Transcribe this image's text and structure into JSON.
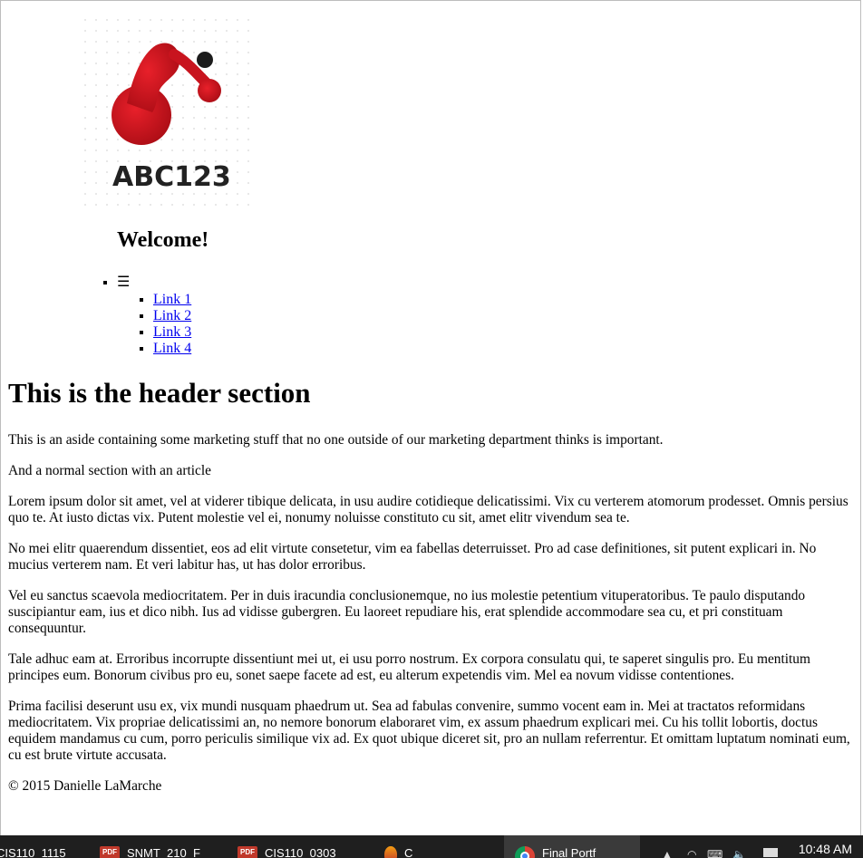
{
  "logo": {
    "text": "ABC123",
    "colors": {
      "primary": "#c8141e",
      "dot": "#1c1c1c",
      "text": "#222222"
    }
  },
  "nav": {
    "welcome": "Welcome!",
    "menu_icon": "☰",
    "links": [
      "Link 1",
      "Link 2",
      "Link 3",
      "Link 4"
    ]
  },
  "header": {
    "title": "This is the header section"
  },
  "aside": {
    "text": "This is an aside containing some marketing stuff that no one outside of our marketing department thinks is important."
  },
  "section": {
    "intro": "And a normal section with an article",
    "paragraphs": [
      "Lorem ipsum dolor sit amet, vel at viderer tibique delicata, in usu audire cotidieque delicatissimi. Vix cu verterem atomorum prodesset. Omnis persius quo te. At iusto dictas vix. Putent molestie vel ei, nonumy noluisse constituto cu sit, amet elitr vivendum sea te.",
      "No mei elitr quaerendum dissentiet, eos ad elit virtute consetetur, vim ea fabellas deterruisset. Pro ad case definitiones, sit putent explicari in. No mucius verterem nam. Et veri labitur has, ut has dolor erroribus.",
      "Vel eu sanctus scaevola mediocritatem. Per in duis iracundia conclusionemque, no ius molestie petentium vituperatoribus. Te paulo disputando suscipiantur eam, ius et dico nibh. Ius ad vidisse gubergren. Eu laoreet repudiare his, erat splendide accommodare sea cu, et pri constituam consequuntur.",
      "Tale adhuc eam at. Erroribus incorrupte dissentiunt mei ut, ei usu porro nostrum. Ex corpora consulatu qui, te saperet singulis pro. Eu mentitum principes eum. Bonorum civibus pro eu, sonet saepe facete ad est, eu alterum expetendis vim. Mel ea novum vidisse contentiones.",
      "Prima facilisi deserunt usu ex, vix mundi nusquam phaedrum ut. Sea ad fabulas convenire, summo vocent eam in. Mei at tractatos reformidans mediocritatem. Vix propriae delicatissimi an, no nemore bonorum elaboraret vim, ex assum phaedrum explicari mei. Cu his tollit lobortis, doctus equidem mandamus cu cum, porro periculis similique vix ad. Ex quot ubique diceret sit, pro an nullam referrentur. Et omittam luptatum nominati eum, cu est brute virtute accusata."
    ]
  },
  "footer": {
    "text": "© 2015 Danielle LaMarche"
  },
  "taskbar": {
    "items": [
      {
        "label": "CIS110_1115",
        "icon": "window-icon"
      },
      {
        "label": "SNMT_210_F",
        "icon": "pdf-icon"
      },
      {
        "label": "CIS110_0303",
        "icon": "pdf-icon"
      },
      {
        "label": "C",
        "icon": "app-icon"
      },
      {
        "label": "Final Portf",
        "icon": "chrome-icon"
      }
    ],
    "pdf_badge": "PDF",
    "clock": "10:48 AM"
  }
}
